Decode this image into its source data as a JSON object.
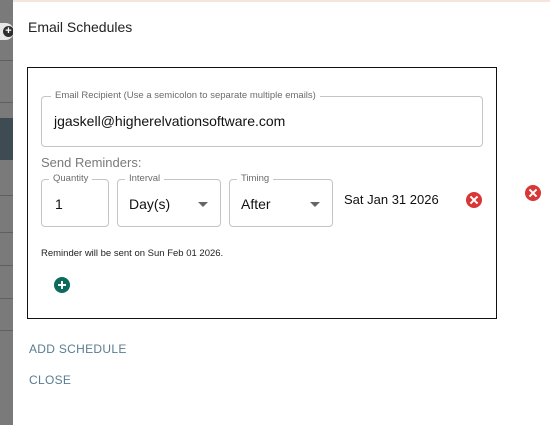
{
  "dialog": {
    "title": "Email Schedules",
    "add_schedule_label": "ADD SCHEDULE",
    "close_label": "CLOSE"
  },
  "schedule": {
    "recipient_label": "Email Recipient (Use a semicolon to separate multiple emails)",
    "recipient_value": "jgaskell@higherelvationsoftware.com",
    "send_reminders_label": "Send Reminders:",
    "quantity_label": "Quantity",
    "quantity_value": "1",
    "interval_label": "Interval",
    "interval_value": "Day(s)",
    "timing_label": "Timing",
    "timing_value": "After",
    "schedule_date": "Sat Jan 31 2026",
    "reminder_note": "Reminder will be sent on Sun Feb 01 2026."
  },
  "colors": {
    "remove": "#d93636",
    "add": "#0d6b5c",
    "text_button": "#5a7c92"
  },
  "icons": {
    "remove_reminder": "close-circle-icon",
    "remove_schedule": "close-circle-icon",
    "add_reminder": "plus-circle-icon"
  }
}
